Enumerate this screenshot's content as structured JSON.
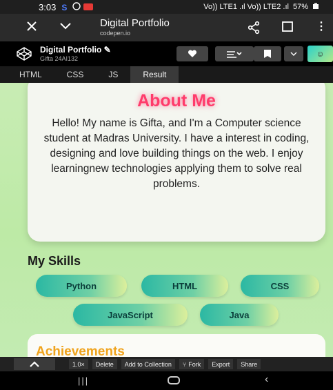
{
  "status": {
    "time": "3:03",
    "battery": "57%",
    "signal_text": "Vo)) LTE1 .ıl Vo)) LTE2 .ıl"
  },
  "browser": {
    "title": "Digital Portfolio",
    "url": "codepen.io"
  },
  "codepen": {
    "pen_name": "Digital Portfolio",
    "user": "Gifta 24AI132"
  },
  "tabs": [
    {
      "label": "HTML"
    },
    {
      "label": "CSS"
    },
    {
      "label": "JS"
    },
    {
      "label": "Result"
    }
  ],
  "result": {
    "about_title": "About Me",
    "about_text": "Hello! My name is Gifta, and I'm a Computer science student at Madras University. I have a interest in coding, designing and love building things on the web. I enjoy learningnew technologies applying them to solve real problems.",
    "skills_heading": "My Skills",
    "skills": [
      "Python",
      "HTML",
      "CSS",
      "JavaScript",
      "Java"
    ],
    "achievements_title": "Achievements"
  },
  "bottom_bar": {
    "zoom": "1.0×",
    "delete": "Delete",
    "add_collection": "Add to Collection",
    "fork": "Fork",
    "export": "Export",
    "share": "Share"
  },
  "colors": {
    "accent_pink": "#ff3b6b",
    "achievements_orange": "#f0a31c",
    "pill_teal": "#2bb8a3"
  }
}
